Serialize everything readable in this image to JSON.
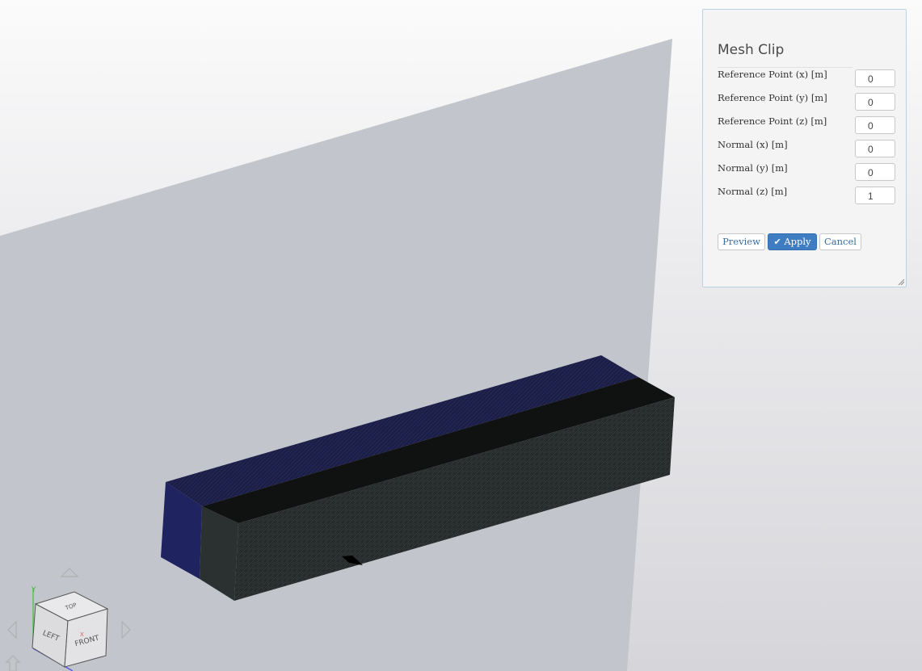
{
  "panel": {
    "title": "Mesh Clip",
    "fields": [
      {
        "label": "Reference Point (x) [m]",
        "value": "0"
      },
      {
        "label": "Reference Point (y) [m]",
        "value": "0"
      },
      {
        "label": "Reference Point (z) [m]",
        "value": "0"
      },
      {
        "label": "Normal (x) [m]",
        "value": "0"
      },
      {
        "label": "Normal (y) [m]",
        "value": "0"
      },
      {
        "label": "Normal (z) [m]",
        "value": "1"
      }
    ],
    "buttons": {
      "preview": "Preview",
      "apply": "Apply",
      "cancel": "Cancel"
    }
  },
  "view_cube": {
    "faces": {
      "top": "TOP",
      "left": "LEFT",
      "front": "FRONT"
    },
    "axes": {
      "y": "Y",
      "x": "X"
    }
  },
  "colors": {
    "clip_plane": "#c3c5cc",
    "mesh_top": "#1c1f4a",
    "mesh_side": "#262a2a",
    "accent": "#3f7dc2"
  }
}
